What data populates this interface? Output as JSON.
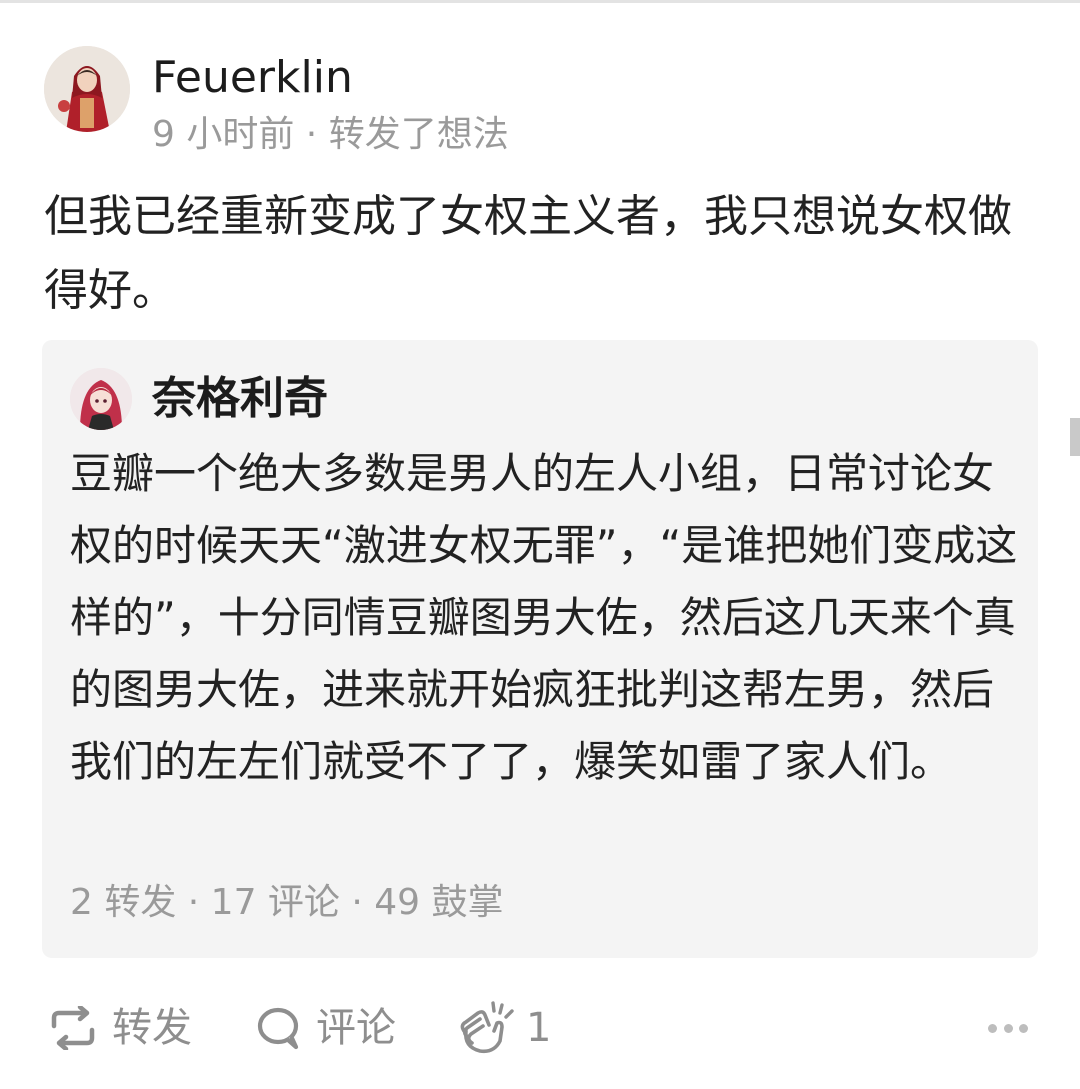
{
  "post": {
    "author_name": "Feuerklin",
    "time": "9 小时前",
    "separator": " · ",
    "action_text": "转发了想法",
    "body": "但我已经重新变成了女权主义者，我只想说女权做得好。"
  },
  "quote": {
    "author_name": "奈格利奇",
    "body": "豆瓣一个绝大多数是男人的左人小组，日常讨论女权的时候天天“激进女权无罪”，“是谁把她们变成这样的”，十分同情豆瓣图男大佐，然后这几天来个真的图男大佐，进来就开始疯狂批判这帮左男，然后我们的左左们就受不了了，爆笑如雷了家人们。",
    "stats": "2 转发 · 17 评论 · 49 鼓掌"
  },
  "actions": {
    "repost_label": "转发",
    "comment_label": "评论",
    "clap_count": "1",
    "repost_icon": "repost-icon",
    "comment_icon": "comment-bubble-icon",
    "clap_icon": "clap-icon",
    "more_icon": "more-dots-icon"
  },
  "colors": {
    "text": "#222222",
    "muted": "#9a9a9a",
    "card_bg": "#f4f4f4",
    "icon": "#8e8e8e"
  }
}
